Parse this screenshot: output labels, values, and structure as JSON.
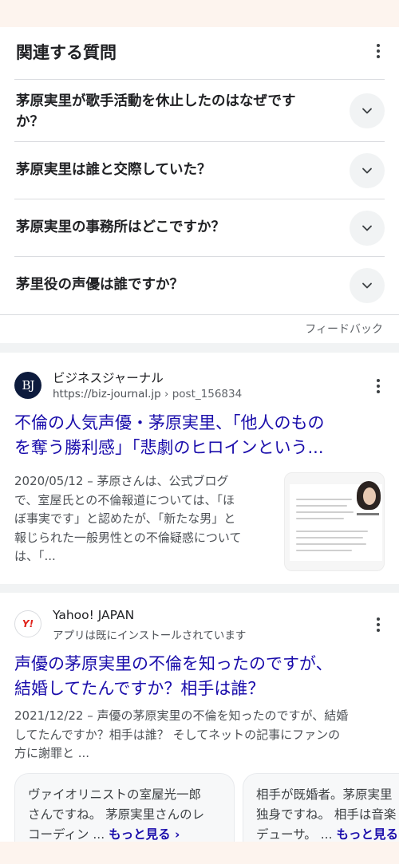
{
  "paa": {
    "title": "関連する質問",
    "questions": [
      {
        "line1": "茅原実里が歌手活動を休止したのはなぜです",
        "line2": "か？"
      },
      {
        "line1": "茅原実里は誰と交際していた？",
        "line2": ""
      },
      {
        "line1": "茅原実里の事務所はどこですか？",
        "line2": ""
      },
      {
        "line1": "茅里役の声優は誰ですか？",
        "line2": ""
      }
    ],
    "feedback": "フィードバック"
  },
  "result1": {
    "favicon_text": "BJ",
    "site_name": "ビジネスジャーナル",
    "url": "https://biz-journal.jp",
    "crumb": " › post_156834",
    "title_line1": "不倫の人気声優・茅原実里、「他人のもの",
    "title_line2": "を奪う勝利感」「悲劇のヒロインという...",
    "date": "2020/05/12",
    "snippet_lines": [
      "2020/05/12 – 茅原さんは、公式ブログ",
      "で、室屋氏との不倫報道については、「ほ",
      "ぼ事実です」と認めたが、「新たな男」と",
      "報じられた一般男性との不倫疑惑について",
      "は、「..."
    ]
  },
  "result2": {
    "favicon_text": "Y!",
    "site_name": "Yahoo! JAPAN",
    "subtitle": "アプリは既にインストールされています",
    "title_line1": "声優の茅原実里の不倫を知ったのですが、",
    "title_line2": "結婚してたんですか？相手は誰？",
    "snippet_lines": [
      "2021/12/22 – 声優の茅原実里の不倫を知ったのですが、結婚",
      "してたんですか？相手は誰？ そしてネットの記事にファンの",
      "方に謝罪と ..."
    ],
    "answers": [
      {
        "lines": [
          "ヴァイオリニストの室屋光一郎",
          "さんですね。 茅原実里さんのレ",
          "コーディン ... "
        ],
        "more": "もっと見る ›"
      },
      {
        "lines": [
          "相手が既婚者。茅原実里",
          "独身ですね。 相手は音楽",
          "デューサ。 ... "
        ],
        "more": "もっと見る ›"
      }
    ]
  }
}
